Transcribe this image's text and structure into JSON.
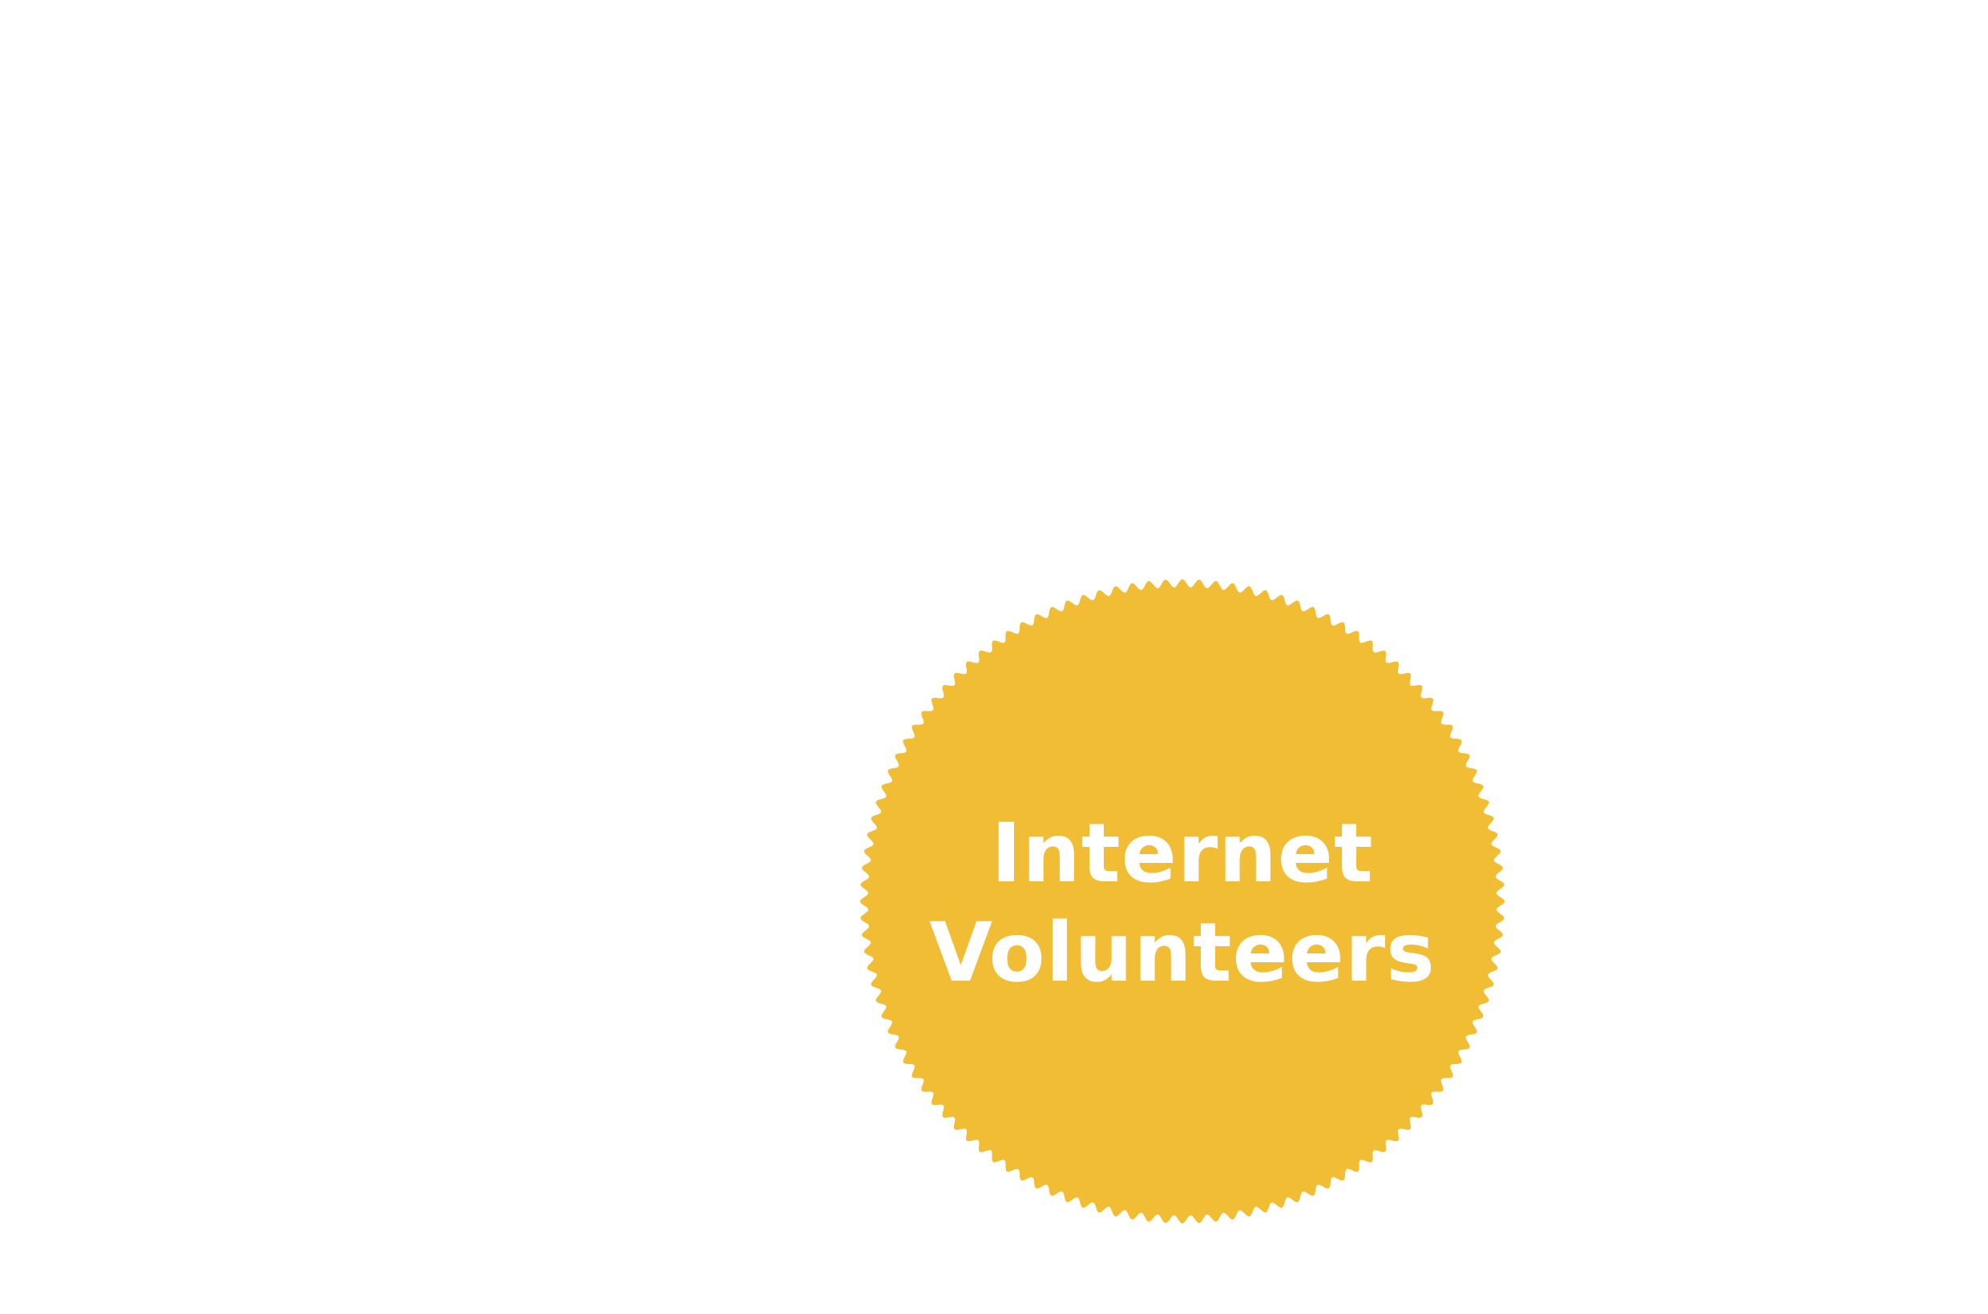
{
  "badge": {
    "line1": "Internet",
    "line2": "Volunteers",
    "fill_color": "#F0BD34",
    "text_color": "#FFFFFF",
    "background_color": "#FFFFFF"
  }
}
